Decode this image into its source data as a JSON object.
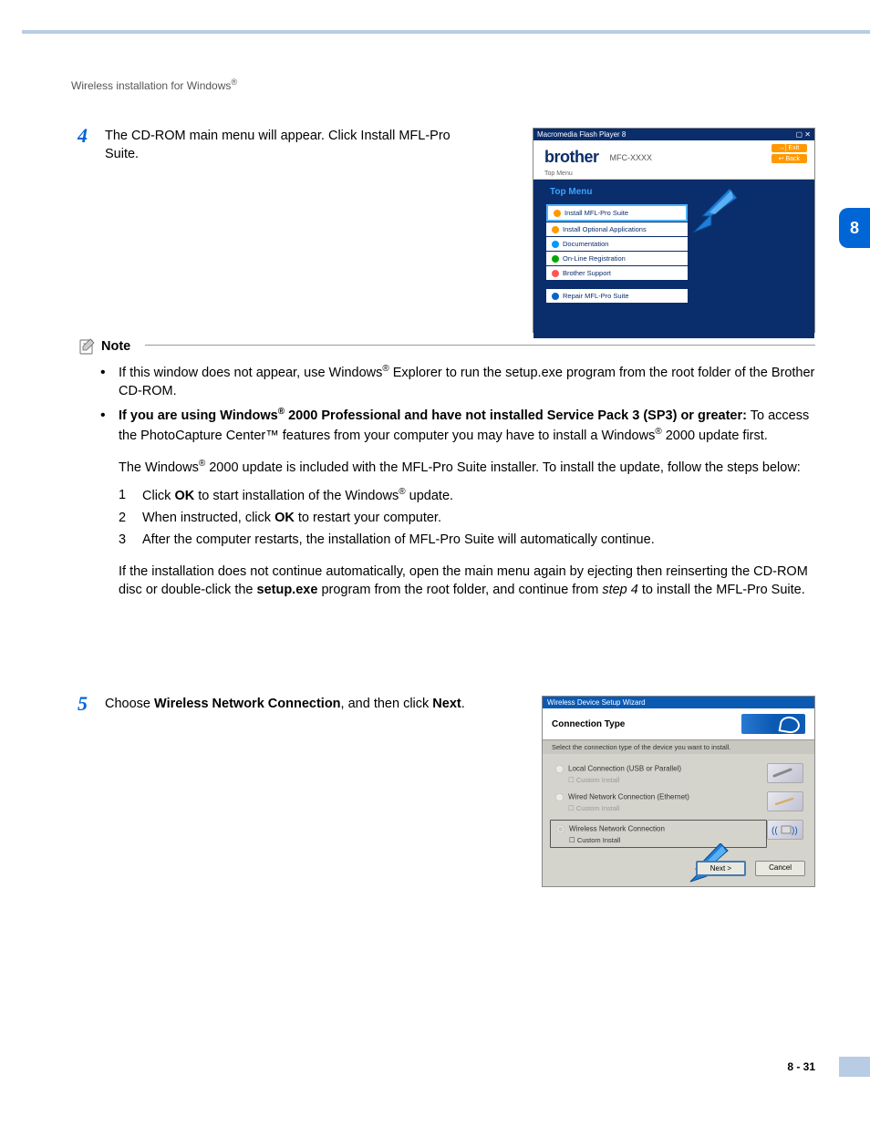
{
  "header": {
    "text": "Wireless installation for Windows",
    "reg": "®"
  },
  "chapter_number": "8",
  "step4": {
    "number": "4",
    "text_before": "The CD-ROM main menu will appear. Click Install MFL-Pro Suite."
  },
  "screenshot1": {
    "window_title": "Macromedia Flash Player 8",
    "brand": "brother",
    "model": "MFC-XXXX",
    "exit": "Exit",
    "back": "Back",
    "top_menu_small": "Top Menu",
    "heading": "Top Menu",
    "items": [
      "Install MFL-Pro Suite",
      "Install Optional Applications",
      "Documentation",
      "On-Line Registration",
      "Brother Support"
    ],
    "repair": "Repair MFL-Pro Suite"
  },
  "note": {
    "label": "Note",
    "bullet1_a": "If this window does not appear, use Windows",
    "bullet1_b": " Explorer to run the setup.exe program from the root folder of the Brother CD-ROM.",
    "bullet2_bold_a": "If you are using Windows",
    "bullet2_bold_b": " 2000 Professional and have not installed Service Pack 3 (SP3) or greater:",
    "bullet2_rest": " To access the PhotoCapture Center™ features from your computer you may have to install a Windows",
    "bullet2_rest2": " 2000 update first.",
    "para1_a": "The Windows",
    "para1_b": " 2000 update is included with the MFL-Pro Suite installer. To install the update, follow the steps below:",
    "sub1_a": "Click ",
    "sub1_ok": "OK",
    "sub1_b": " to start installation of the Windows",
    "sub1_c": " update.",
    "sub2_a": "When instructed, click ",
    "sub2_ok": "OK",
    "sub2_b": " to restart your computer.",
    "sub3": "After the computer restarts, the installation of MFL-Pro Suite will automatically continue.",
    "para2_a": "If the installation does not continue automatically, open the main menu again by ejecting then reinserting the CD-ROM disc or double-click the ",
    "para2_setup": "setup.exe",
    "para2_b": " program from the root folder, and continue from ",
    "para2_step": "step 4",
    "para2_c": " to install the MFL-Pro Suite."
  },
  "step5": {
    "number": "5",
    "text_a": "Choose ",
    "text_bold1": "Wireless Network Connection",
    "text_b": ", and then click ",
    "text_bold2": "Next",
    "text_c": "."
  },
  "screenshot2": {
    "window_title": "Wireless Device Setup Wizard",
    "header": "Connection Type",
    "subtitle": "Select the connection type of the device you want to install.",
    "opt1": "Local Connection (USB or Parallel)",
    "opt2": "Wired Network Connection (Ethernet)",
    "opt3": "Wireless Network Connection",
    "custom": "Custom Install",
    "next": "Next >",
    "cancel": "Cancel"
  },
  "page_number": "8 - 31"
}
